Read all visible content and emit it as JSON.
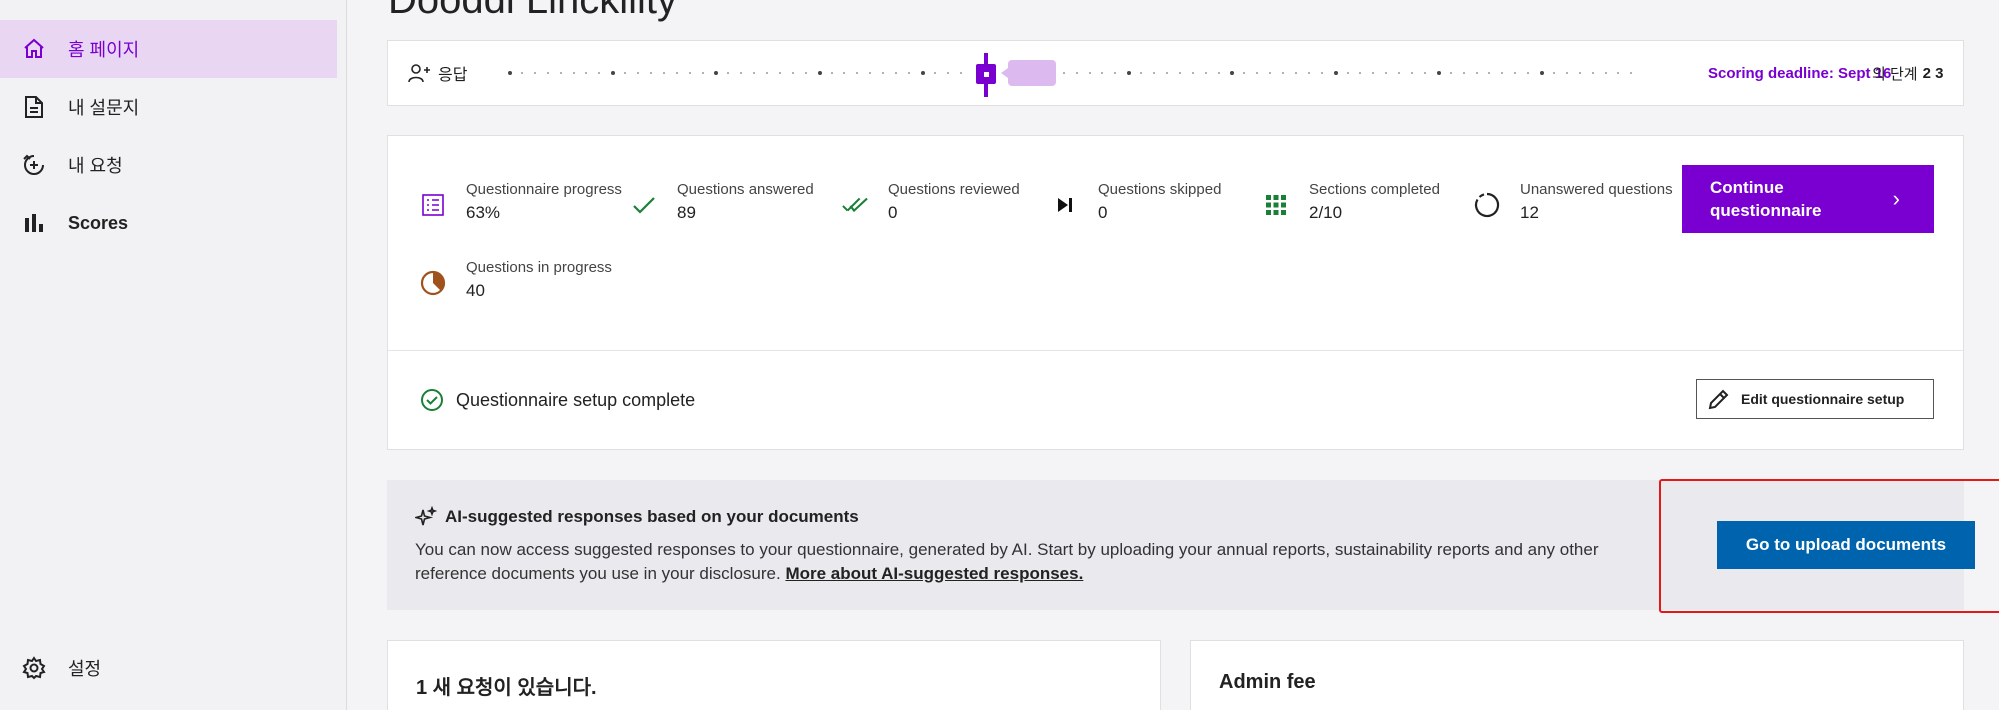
{
  "sidebar": {
    "items": [
      {
        "label": "홈 페이지",
        "icon": "home-icon"
      },
      {
        "label": "내 설문지",
        "icon": "document-icon"
      },
      {
        "label": "내 요청",
        "icon": "add-circle-icon"
      },
      {
        "label": "Scores",
        "icon": "bar-chart-icon"
      }
    ],
    "settings_label": "설정"
  },
  "main": {
    "page_title": "Dooddi Linckility",
    "stage_bar": {
      "label": "응답",
      "deadline": "Scoring deadline: Sept 16",
      "stage_prefix": "의 단계",
      "stage_value": "2 3"
    },
    "stats": [
      {
        "label": "Questionnaire progress",
        "value": "63%",
        "icon": "checklist-icon"
      },
      {
        "label": "Questions answered",
        "value": "89",
        "icon": "check-icon"
      },
      {
        "label": "Questions reviewed",
        "value": "0",
        "icon": "double-check-icon"
      },
      {
        "label": "Questions skipped",
        "value": "0",
        "icon": "skip-next-icon"
      },
      {
        "label": "Sections completed",
        "value": "2/10",
        "icon": "grid-icon"
      },
      {
        "label": "Unanswered questions",
        "value": "12",
        "icon": "circle-dashed-icon"
      },
      {
        "label": "Questions in progress",
        "value": "40",
        "icon": "pie-progress-icon"
      }
    ],
    "continue_button": {
      "line1": "Continue",
      "line2": "questionnaire"
    },
    "setup_status": "Questionnaire setup complete",
    "edit_setup_label": "Edit questionnaire setup",
    "ai_banner": {
      "title": "AI-suggested responses based on your documents",
      "description": "You can now access suggested responses to your questionnaire, generated by AI. Start by uploading your annual reports, sustainability reports and any other reference documents you use in your disclosure.",
      "link": "More about AI-suggested responses.",
      "button": "Go to upload documents"
    },
    "bottom_cards": [
      {
        "title": "1 새 요청이 있습니다."
      },
      {
        "title": "Admin fee"
      }
    ]
  },
  "colors": {
    "accent": "#7a00d1",
    "primary_blue": "#0063ad",
    "success": "#1a7f37",
    "highlight": "#e31818"
  }
}
